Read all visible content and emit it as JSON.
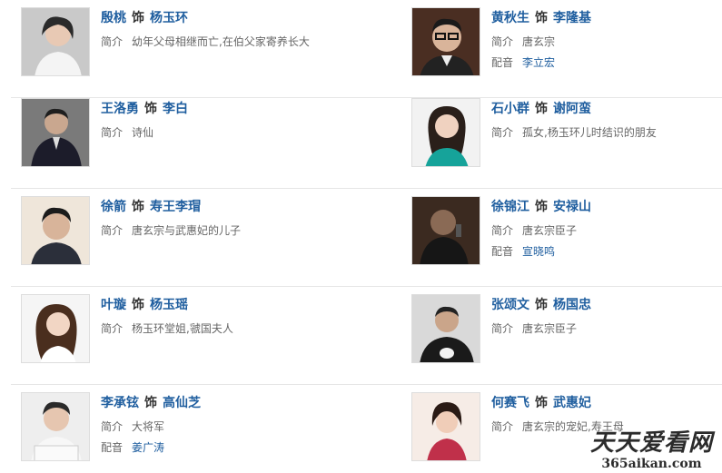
{
  "cast": [
    {
      "left": {
        "actor": "殷桃",
        "as": "饰",
        "role": "杨玉环",
        "intro_label": "简介",
        "intro": "幼年父母相继而亡,在伯父家寄养长大",
        "voice_label": "",
        "voice": ""
      },
      "right": {
        "actor": "黄秋生",
        "as": "饰",
        "role": "李隆基",
        "intro_label": "简介",
        "intro": "唐玄宗",
        "voice_label": "配音",
        "voice": "李立宏"
      }
    },
    {
      "left": {
        "actor": "王洛勇",
        "as": "饰",
        "role": "李白",
        "intro_label": "简介",
        "intro": "诗仙",
        "voice_label": "",
        "voice": ""
      },
      "right": {
        "actor": "石小群",
        "as": "饰",
        "role": "谢阿蛮",
        "intro_label": "简介",
        "intro": "孤女,杨玉环儿时结识的朋友",
        "voice_label": "",
        "voice": ""
      }
    },
    {
      "left": {
        "actor": "徐箭",
        "as": "饰",
        "role": "寿王李瑁",
        "intro_label": "简介",
        "intro": "唐玄宗与武惠妃的儿子",
        "voice_label": "",
        "voice": ""
      },
      "right": {
        "actor": "徐锦江",
        "as": "饰",
        "role": "安禄山",
        "intro_label": "简介",
        "intro": "唐玄宗臣子",
        "voice_label": "配音",
        "voice": "宣晓鸣"
      }
    },
    {
      "left": {
        "actor": "叶璇",
        "as": "饰",
        "role": "杨玉瑶",
        "intro_label": "简介",
        "intro": "杨玉环堂姐,虢国夫人",
        "voice_label": "",
        "voice": ""
      },
      "right": {
        "actor": "张颂文",
        "as": "饰",
        "role": "杨国忠",
        "intro_label": "简介",
        "intro": "唐玄宗臣子",
        "voice_label": "",
        "voice": ""
      }
    },
    {
      "left": {
        "actor": "李承铉",
        "as": "饰",
        "role": "高仙芝",
        "intro_label": "简介",
        "intro": "大将军",
        "voice_label": "配音",
        "voice": "姜广涛"
      },
      "right": {
        "actor": "何赛飞",
        "as": "饰",
        "role": "武惠妃",
        "intro_label": "简介",
        "intro": "唐玄宗的宠妃,寿王母",
        "voice_label": "",
        "voice": ""
      }
    }
  ],
  "watermark": {
    "main": "天天爱看网",
    "url": "365aikan.com"
  },
  "colors": {
    "link": "#1f5e9f",
    "text": "#666666",
    "divider": "#e6e6e6"
  }
}
